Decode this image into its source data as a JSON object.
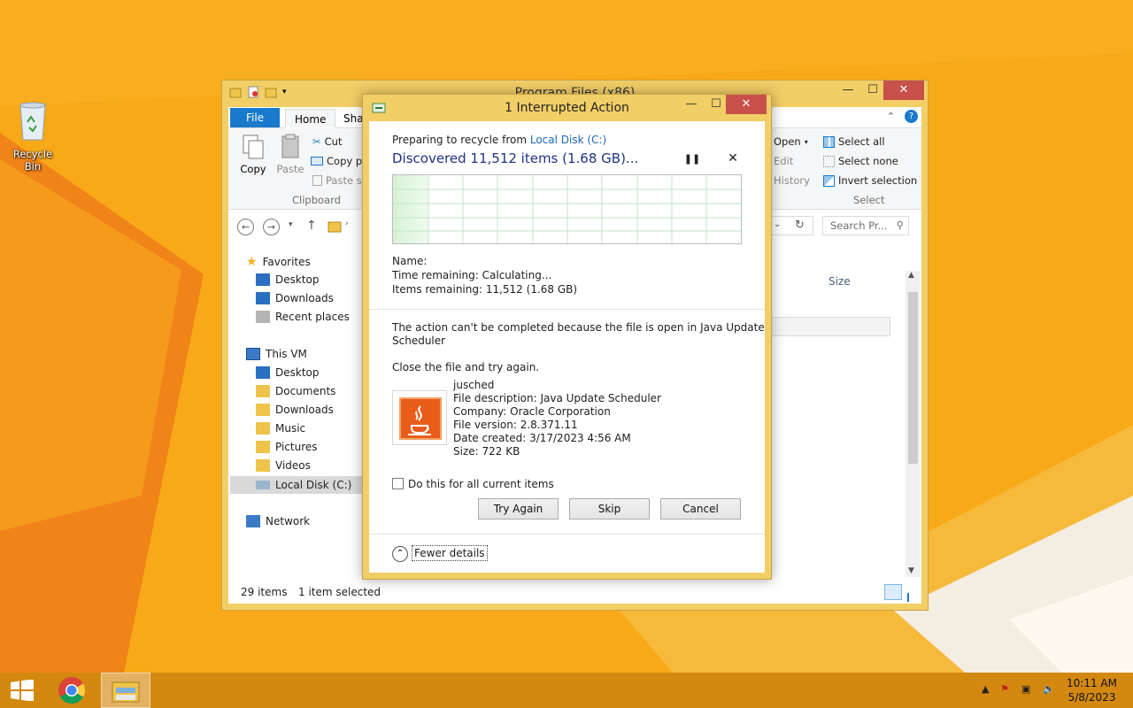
{
  "desktop": {
    "recycle_bin_label": "Recycle Bin"
  },
  "explorer": {
    "title": "Program Files (x86)",
    "tabs": {
      "file": "File",
      "home": "Home",
      "share": "Shar"
    },
    "ribbon": {
      "copy": "Copy",
      "paste": "Paste",
      "cut": "Cut",
      "copy_path": "Copy pa",
      "paste_shortcut": "Paste sh",
      "clipboard_group": "Clipboard",
      "open": "Open",
      "edit": "Edit",
      "history": "History",
      "select_all": "Select all",
      "select_none": "Select none",
      "invert_selection": "Invert selection",
      "select_group": "Select"
    },
    "search_placeholder": "Search Pr...",
    "nav": {
      "favorites": "Favorites",
      "fav_desktop": "Desktop",
      "fav_downloads": "Downloads",
      "recent_places": "Recent places",
      "this_vm": "This VM",
      "vm_desktop": "Desktop",
      "vm_documents": "Documents",
      "vm_downloads": "Downloads",
      "vm_music": "Music",
      "vm_pictures": "Pictures",
      "vm_videos": "Videos",
      "local_disk": "Local Disk (C:)",
      "network": "Network"
    },
    "column_size": "Size",
    "status": {
      "items": "29 items",
      "selected": "1 item selected"
    }
  },
  "dialog": {
    "title": "1 Interrupted Action",
    "preparing_prefix": "Preparing to recycle from",
    "preparing_location": "Local Disk (C:)",
    "discovered": "Discovered 11,512 items (1.68 GB)...",
    "name_label": "Name:",
    "time_remaining": "Time remaining:  Calculating...",
    "items_remaining": "Items remaining:  11,512 (1.68 GB)",
    "message_line1": "The action can't be completed because the file is open in Java Update",
    "message_line2": "Scheduler",
    "close_file": "Close the file and try again.",
    "file": {
      "name": "jusched",
      "description": "File description: Java Update Scheduler",
      "company": "Company: Oracle Corporation",
      "version": "File version: 2.8.371.11",
      "date_created": "Date created: 3/17/2023 4:56 AM",
      "size": "Size: 722 KB"
    },
    "do_this_for_all": "Do this for all current items",
    "try_again": "Try Again",
    "skip": "Skip",
    "cancel": "Cancel",
    "fewer_details": "Fewer details"
  },
  "taskbar": {
    "time": "10:11 AM",
    "date": "5/8/2023"
  },
  "colors": {
    "accent_frame": "#f2ce67",
    "file_tab": "#1979ca",
    "close_button": "#c7504a",
    "link": "#1a66b7"
  }
}
